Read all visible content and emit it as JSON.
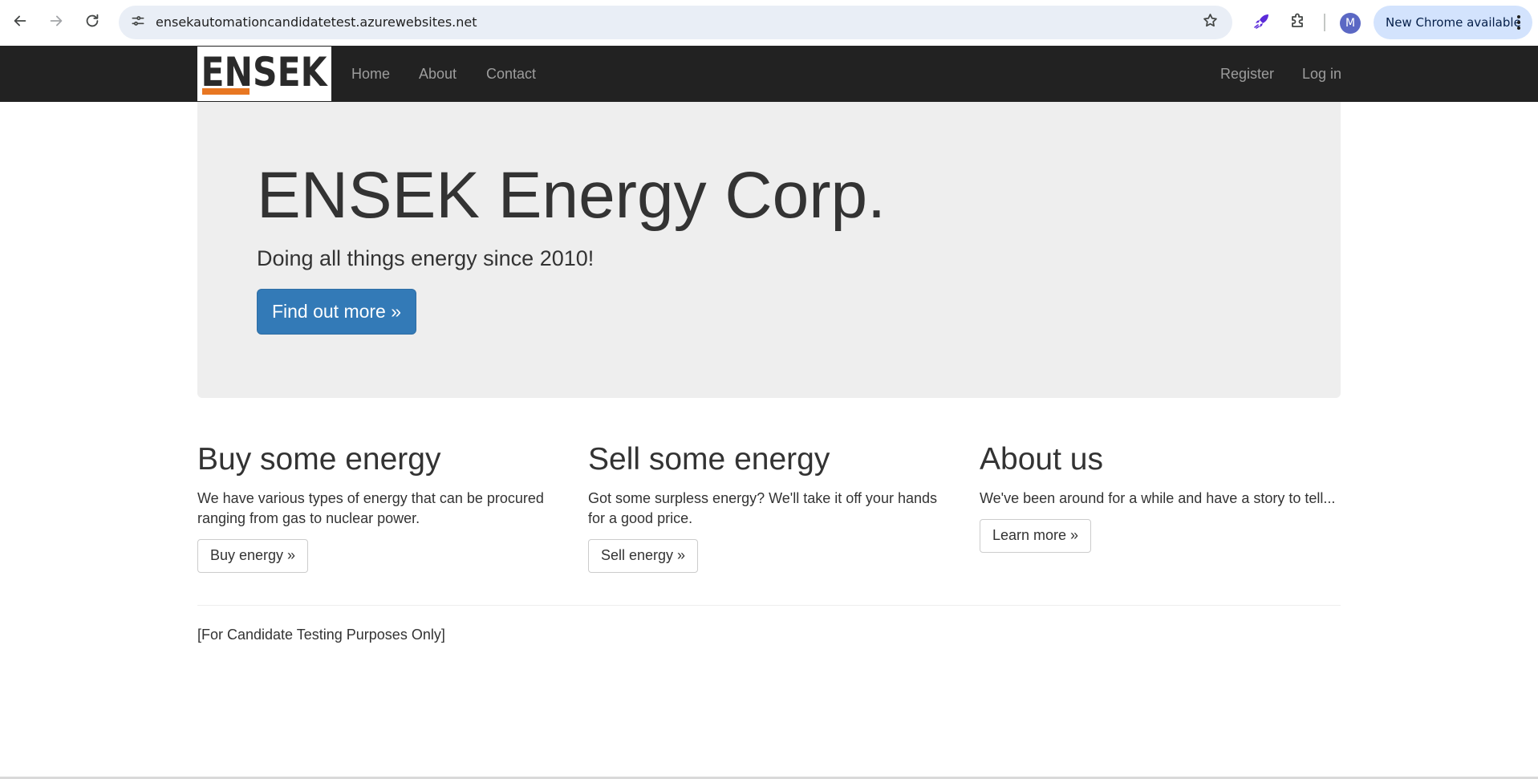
{
  "browser": {
    "url": "ensekautomationcandidatetest.azurewebsites.net",
    "profile_initial": "M",
    "update_chip_label": "New Chrome available",
    "icons": {
      "back": "arrow-left-icon",
      "forward": "arrow-right-icon",
      "reload": "reload-icon",
      "site_info": "tune-icon",
      "bookmark": "star-icon",
      "extension_pinned": "rocket-icon",
      "extensions": "puzzle-icon",
      "menu": "kebab-menu-icon"
    }
  },
  "navbar": {
    "brand": "ENSEK",
    "left_links": [
      "Home",
      "About",
      "Contact"
    ],
    "right_links": [
      "Register",
      "Log in"
    ],
    "colors": {
      "background": "#222222",
      "link": "#9d9d9d",
      "brand_accent": "#e87722"
    }
  },
  "jumbotron": {
    "title": "ENSEK Energy Corp.",
    "lead": "Doing all things energy since 2010!",
    "button": "Find out more »",
    "colors": {
      "background": "#eeeeee",
      "button": "#337ab7"
    }
  },
  "columns": [
    {
      "heading": "Buy some energy",
      "text": "We have various types of energy that can be procured ranging from gas to nuclear power.",
      "button": "Buy energy »"
    },
    {
      "heading": "Sell some energy",
      "text": "Got some surpless energy? We'll take it off your hands for a good price.",
      "button": "Sell energy »"
    },
    {
      "heading": "About us",
      "text": "We've been around for a while and have a story to tell...",
      "button": "Learn more »"
    }
  ],
  "footer": {
    "text": "[For Candidate Testing Purposes Only]"
  }
}
